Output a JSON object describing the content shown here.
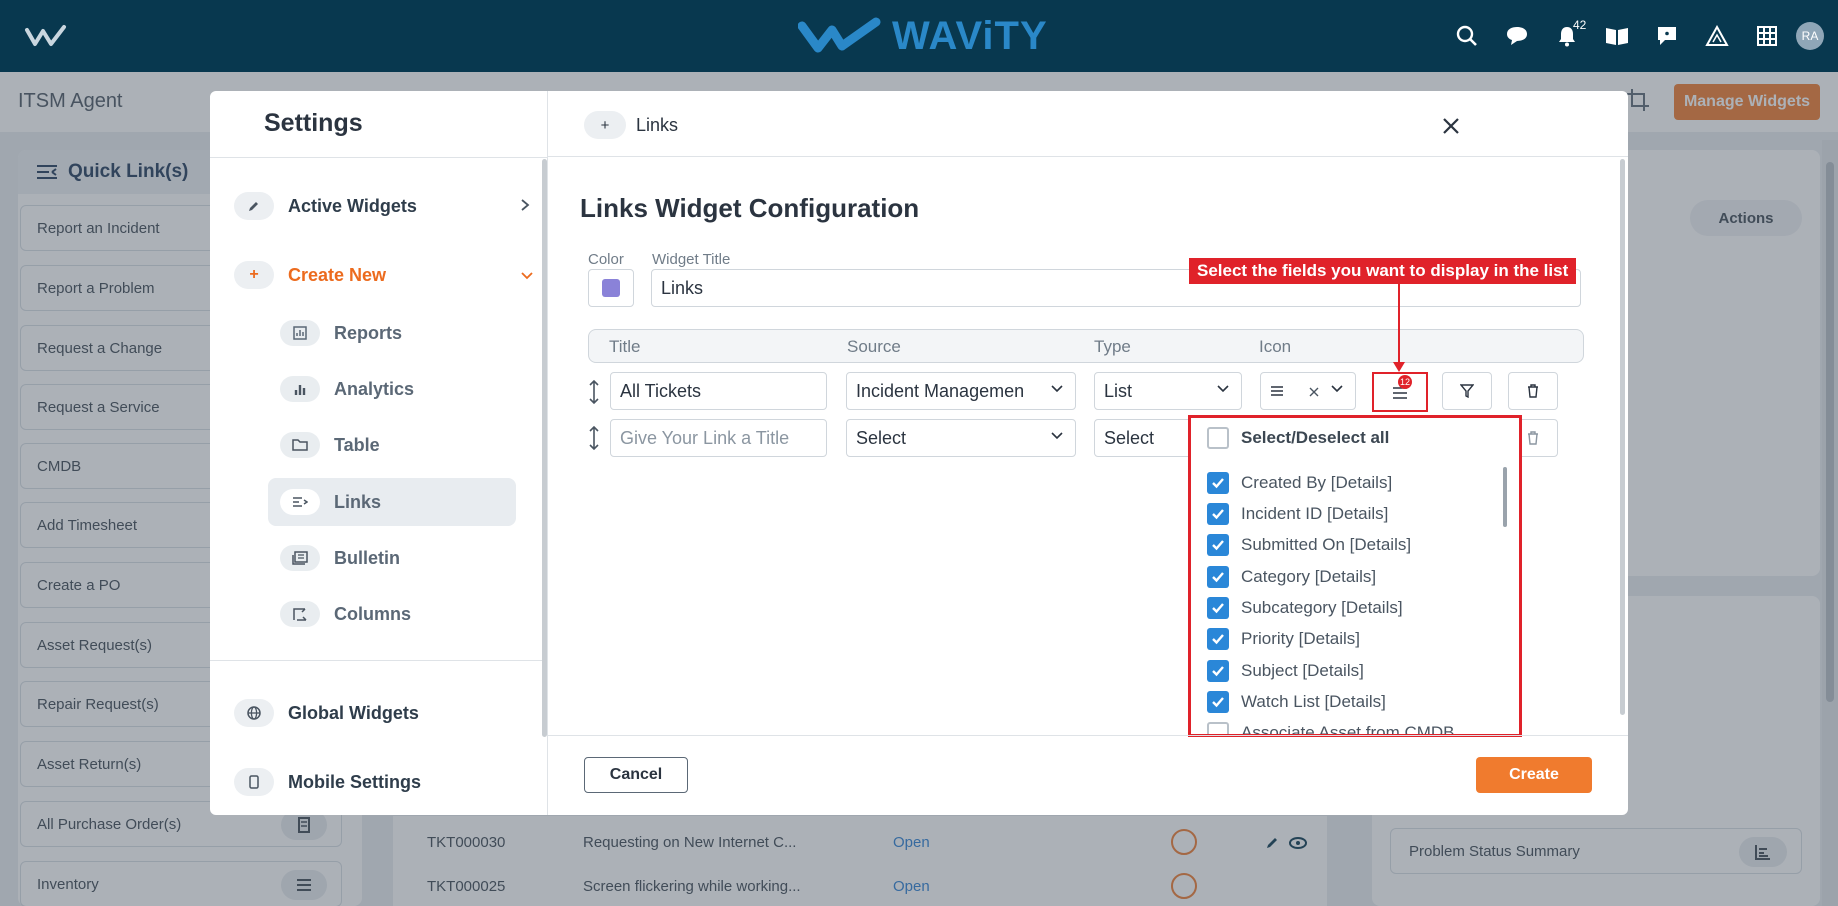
{
  "topbar": {
    "brand": "WAViTY",
    "notification_count": "42",
    "avatar_initials": "RA"
  },
  "page": {
    "title": "ITSM Agent",
    "manage_widgets_label": "Manage Widgets"
  },
  "quick_links": {
    "title": "Quick Link(s)",
    "items": [
      "Report an Incident",
      "Report a Problem",
      "Request a Change",
      "Request a Service",
      "CMDB",
      "Add Timesheet",
      "Create a PO",
      "Asset Request(s)",
      "Repair Request(s)",
      "Asset Return(s)",
      "All Purchase Order(s)",
      "Inventory"
    ]
  },
  "tickets": [
    {
      "id": "TKT000030",
      "subject": "Requesting on New Internet C...",
      "status": "Open"
    },
    {
      "id": "TKT000025",
      "subject": "Screen flickering while working...",
      "status": "Open"
    }
  ],
  "right_panel": {
    "actions_header": "Actions",
    "bottom_items": [
      "Problem Status Summary"
    ]
  },
  "modal": {
    "title": "Settings",
    "nav": {
      "active_widgets": "Active Widgets",
      "create_new": "Create New",
      "sub_items": [
        "Reports",
        "Analytics",
        "Table",
        "Links",
        "Bulletin",
        "Columns"
      ],
      "global_widgets": "Global Widgets",
      "mobile_settings": "Mobile Settings"
    },
    "tab_label": "Links",
    "config_title": "Links Widget Configuration",
    "color_label": "Color",
    "color_value": "#8a82d8",
    "widget_title_label": "Widget Title",
    "widget_title_value": "Links",
    "columns": {
      "title": "Title",
      "source": "Source",
      "type": "Type",
      "icon": "Icon"
    },
    "rows": [
      {
        "title": "All Tickets",
        "source": "Incident Managemen",
        "type": "List"
      },
      {
        "title_placeholder": "Give Your Link a Title",
        "source": "Select",
        "type": "Select"
      }
    ],
    "field_badge_count": "12",
    "callout": "Select the fields you want to display in the list",
    "picker": {
      "select_all": "Select/Deselect all",
      "fields": [
        {
          "label": "Created By [Details]",
          "checked": true
        },
        {
          "label": "Incident ID [Details]",
          "checked": true
        },
        {
          "label": "Submitted On [Details]",
          "checked": true
        },
        {
          "label": "Category [Details]",
          "checked": true
        },
        {
          "label": "Subcategory [Details]",
          "checked": true
        },
        {
          "label": "Priority [Details]",
          "checked": true
        },
        {
          "label": "Subject [Details]",
          "checked": true
        },
        {
          "label": "Watch List [Details]",
          "checked": true
        },
        {
          "label": "Associate Asset from CMDB",
          "checked": false
        }
      ]
    },
    "cancel_label": "Cancel",
    "create_label": "Create"
  }
}
